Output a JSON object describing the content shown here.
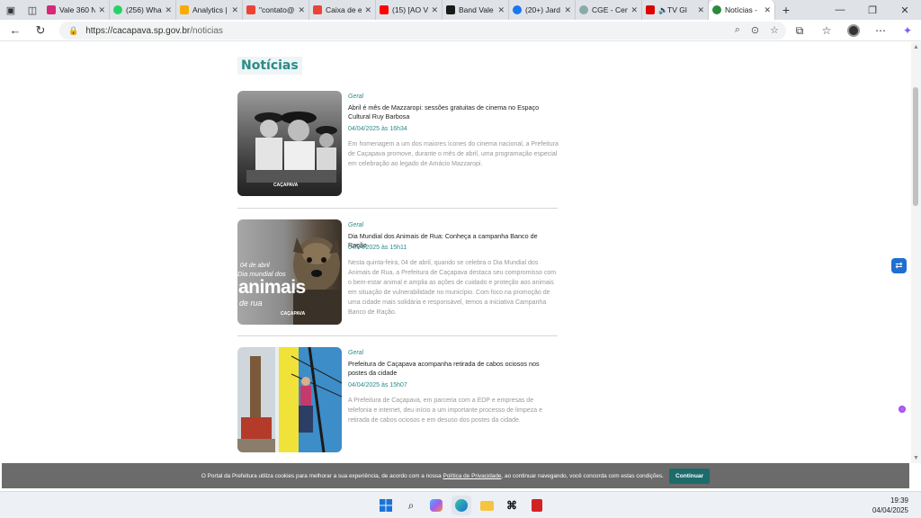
{
  "browser": {
    "tabs": [
      {
        "label": "Vale 360 N",
        "color": "#d62976"
      },
      {
        "label": "(256) Wha",
        "color": "#25d366"
      },
      {
        "label": "Analytics |",
        "color": "#f9ab00"
      },
      {
        "label": "\"contato@",
        "color": "#ea4335"
      },
      {
        "label": "Caixa de e",
        "color": "#ea4335"
      },
      {
        "label": "(15) [AO V",
        "color": "#ff0000"
      },
      {
        "label": "Band Vale",
        "color": "#1a1a1a"
      },
      {
        "label": "(20+) Jard",
        "color": "#1877f2"
      },
      {
        "label": "CGE - Cen",
        "color": "#8aa"
      },
      {
        "label": "TV Gl",
        "color": "#d00"
      },
      {
        "label": "Notícias -",
        "color": "#2b8a3e"
      }
    ],
    "close_glyph": "✕",
    "new_tab": "+",
    "url_host": "https://cacapava.sp.gov.br",
    "url_path": "/noticias"
  },
  "page": {
    "heading": "Notícias",
    "news": [
      {
        "category": "Geral",
        "title": "Abril é mês de Mazzaropi: sessões gratuitas de cinema no Espaço Cultural Ruy Barbosa",
        "date": "04/04/2025 às 16h34",
        "summary": "Em homenagem a um dos maiores ícones do cinema nacional, a Prefeitura de Caçapava promove, durante o mês de abril, uma programação especial em celebração ao legado de Amácio Mazzaropi.",
        "image_logo": "CAÇAPAVA"
      },
      {
        "category": "Geral",
        "title": "Dia Mundial dos Animais de Rua: Conheça a campanha Banco de Ração",
        "date": "04/04/2025 às 15h11",
        "summary": "Nesta quinta-feira, 04 de abril, quando se celebra o Dia Mundial dos Animais de Rua, a Prefeitura de Caçapava destaca seu compromisso com o bem-estar animal e amplia as ações de cuidado e proteção aos animais em situação de vulnerabilidade no município. Com foco na promoção de uma cidade mais solidária e responsável, temos a iniciativa Campanha Banco de Ração.",
        "image_line1": "04 de abril",
        "image_line2": "Dia mundial dos",
        "image_big": "animais",
        "image_line3": "de rua",
        "image_logo": "CAÇAPAVA"
      },
      {
        "category": "Geral",
        "title": "Prefeitura de Caçapava acompanha retirada de cabos ociosos nos postes da cidade",
        "date": "04/04/2025 às 15h07",
        "summary": "A Prefeitura de Caçapava, em parceria com a EDP e empresas de telefonia e internet, deu início a um importante processo de limpeza e retirada de cabos ociosos e em desuso dos postes da cidade."
      }
    ]
  },
  "cookie": {
    "text_before": "O Portal da Prefeitura utiliza cookies para melhorar a sua experiência, de acordo com a nossa ",
    "link": "Política de Privacidade",
    "text_after": ", ao continuar navegando, você concorda com estas condições.",
    "button": "Continuar"
  },
  "taskbar": {
    "time": "19:39",
    "date": "04/04/2025"
  }
}
